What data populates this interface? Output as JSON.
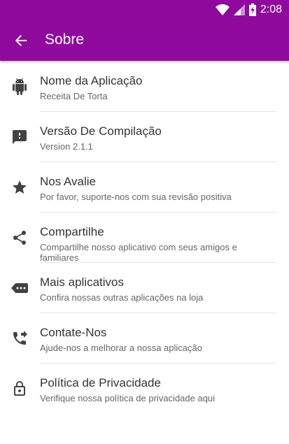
{
  "status_bar": {
    "time": "2:08",
    "icons": [
      "wifi-icon",
      "signal-icon",
      "battery-charging-icon"
    ]
  },
  "toolbar": {
    "title": "Sobre",
    "back_icon": "arrow-back-icon"
  },
  "colors": {
    "primary": "#8f0a9c",
    "icon": "#424242"
  },
  "items": [
    {
      "title": "Nome da Aplicação",
      "subtitle": "Receita De Torta",
      "icon": "android-icon"
    },
    {
      "title": "Versão De Compilação",
      "subtitle": "Version 2.1.1",
      "icon": "feedback-icon"
    },
    {
      "title": "Nos Avalie",
      "subtitle": "Por favor, suporte-nos com sua revisão positiva",
      "icon": "star-icon"
    },
    {
      "title": "Compartilhe",
      "subtitle": "Compartilhe nosso aplicativo com seus amigos e familiares",
      "icon": "share-icon"
    },
    {
      "title": "Mais aplicativos",
      "subtitle": "Confira nossas outras aplicações na loja",
      "icon": "more-apps-icon"
    },
    {
      "title": "Contate-Nos",
      "subtitle": "Ajude-nos a melhorar a nossa aplicação",
      "icon": "phone-forwarded-icon"
    },
    {
      "title": "Política de Privacidade",
      "subtitle": "Verifique nossa política de privacidade aqui",
      "icon": "lock-icon"
    }
  ]
}
